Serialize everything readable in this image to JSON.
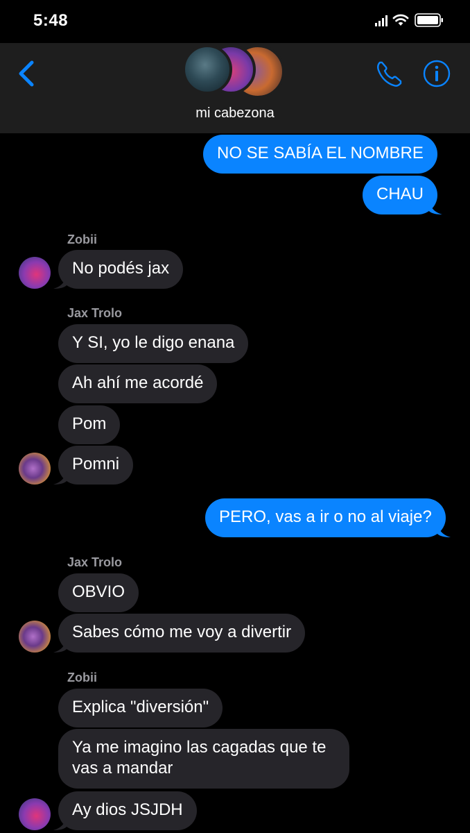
{
  "status_bar": {
    "time": "5:48"
  },
  "header": {
    "group_name": "mi cabezona"
  },
  "colors": {
    "outgoing_bubble": "#0a84ff",
    "incoming_bubble": "#26252a",
    "accent": "#0a84ff"
  },
  "messages": [
    {
      "text": "NO SE SABÍA EL NOMBRE"
    },
    {
      "text": "CHAU"
    },
    {
      "sender": "Zobii"
    },
    {
      "text": "No podés jax"
    },
    {
      "sender": "Jax Trolo"
    },
    {
      "text": "Y SI, yo le digo enana"
    },
    {
      "text": "Ah ahí me acordé"
    },
    {
      "text": "Pom"
    },
    {
      "text": "Pomni"
    },
    {
      "text": "PERO, vas a ir o no al viaje?"
    },
    {
      "sender": "Jax Trolo"
    },
    {
      "text": "OBVIO"
    },
    {
      "text": "Sabes cómo me voy a divertir"
    },
    {
      "sender": "Zobii"
    },
    {
      "text": "Explica \"diversión\""
    },
    {
      "text": "Ya me imagino las cagadas que te vas a mandar"
    },
    {
      "text": "Ay dios JSJDH"
    }
  ]
}
